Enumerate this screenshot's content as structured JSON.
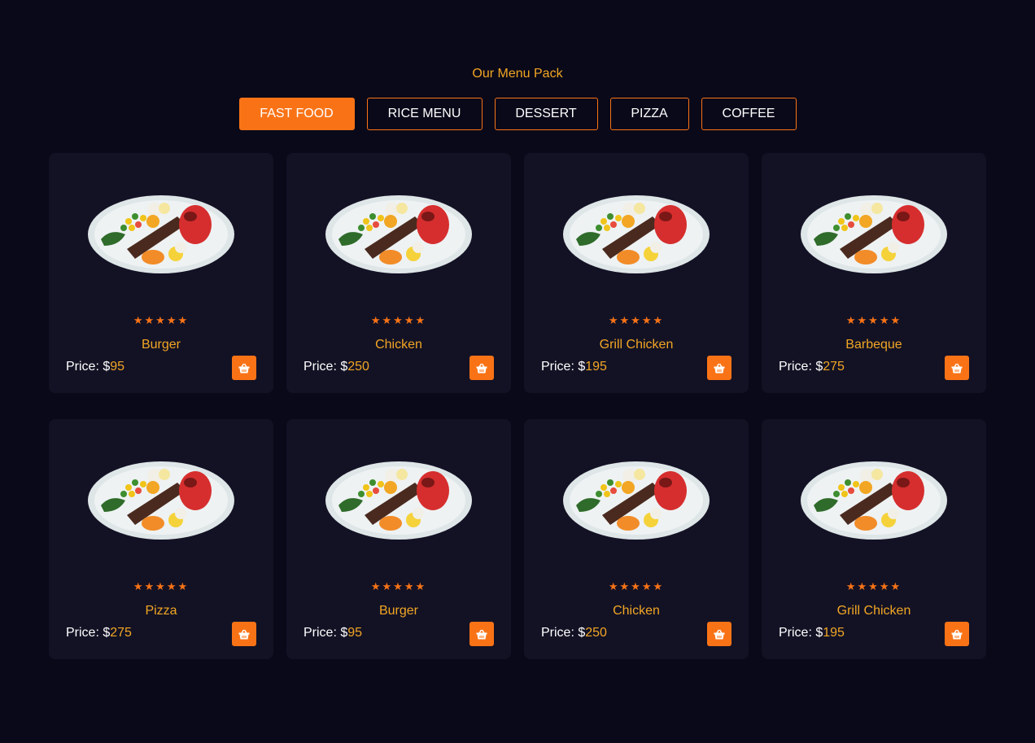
{
  "header": {
    "title": "Our Menu Pack"
  },
  "tabs": [
    {
      "label": "FAST FOOD",
      "active": true
    },
    {
      "label": "RICE MENU",
      "active": false
    },
    {
      "label": "DESSERT",
      "active": false
    },
    {
      "label": "PIZZA",
      "active": false
    },
    {
      "label": "COFFEE",
      "active": false
    }
  ],
  "price_prefix": "Price: $",
  "rating_stars": 5,
  "colors": {
    "background": "#0a0919",
    "card": "#131225",
    "accent": "#f97316",
    "text_highlight": "#f2a623"
  },
  "items": [
    {
      "name": "Burger",
      "price": "95",
      "stars": "★★★★★",
      "icon": "basket-icon"
    },
    {
      "name": "Chicken",
      "price": "250",
      "stars": "★★★★★",
      "icon": "basket-icon"
    },
    {
      "name": "Grill Chicken",
      "price": "195",
      "stars": "★★★★★",
      "icon": "basket-icon"
    },
    {
      "name": "Barbeque",
      "price": "275",
      "stars": "★★★★★",
      "icon": "basket-icon"
    },
    {
      "name": "Pizza",
      "price": "275",
      "stars": "★★★★★",
      "icon": "basket-icon"
    },
    {
      "name": "Burger",
      "price": "95",
      "stars": "★★★★★",
      "icon": "basket-icon"
    },
    {
      "name": "Chicken",
      "price": "250",
      "stars": "★★★★★",
      "icon": "basket-icon"
    },
    {
      "name": "Grill Chicken",
      "price": "195",
      "stars": "★★★★★",
      "icon": "basket-icon"
    }
  ]
}
